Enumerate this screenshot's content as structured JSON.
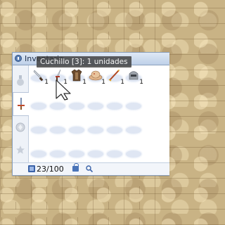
{
  "window": {
    "title": "Inventario"
  },
  "tooltip": {
    "text": "Cuchillo [3]: 1 unidades"
  },
  "sidebar": {
    "tabs": [
      {
        "name": "usable",
        "icon": "potion-icon",
        "active": false
      },
      {
        "name": "equip",
        "icon": "sword-icon",
        "active": true
      },
      {
        "name": "etc",
        "icon": "gem-icon",
        "active": false
      },
      {
        "name": "favorite",
        "icon": "star-icon",
        "active": false
      }
    ]
  },
  "items": [
    {
      "name": "Cuchillo",
      "icon": "knife-icon",
      "qty": "1"
    },
    {
      "name": "dagger",
      "icon": "dagger-icon",
      "qty": "1"
    },
    {
      "name": "armor",
      "icon": "armor-icon",
      "qty": "1"
    },
    {
      "name": "hat",
      "icon": "hat-icon",
      "qty": "1"
    },
    {
      "name": "bow",
      "icon": "bow-icon",
      "qty": "1"
    },
    {
      "name": "helm",
      "icon": "helm-icon",
      "qty": "1"
    }
  ],
  "status": {
    "count": "23/100"
  },
  "colors": {
    "frame": "#8aa0bd",
    "slot": "#dfe6f3",
    "tooltip_bg": "#3c3c3c"
  }
}
